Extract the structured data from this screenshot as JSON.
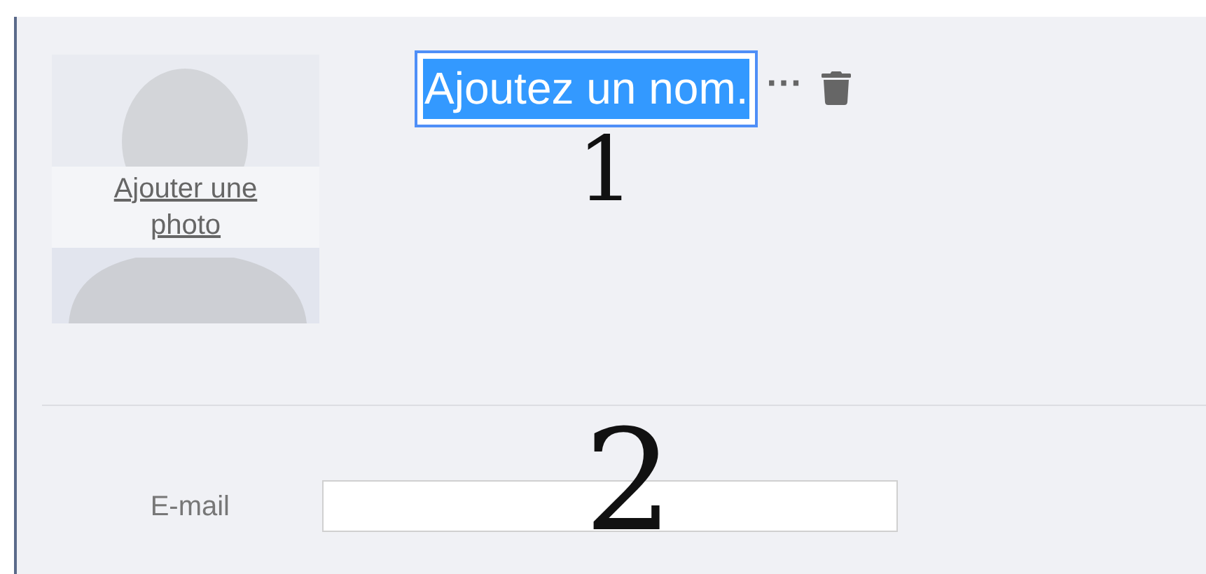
{
  "photo": {
    "link": "Ajouter une photo"
  },
  "name_field": {
    "value": "Ajoutez un nom.",
    "selected": true
  },
  "more_button": {
    "label": "···"
  },
  "fields": [
    {
      "label": "E-mail"
    }
  ],
  "annotations": [
    {
      "text": "1"
    },
    {
      "text": "2"
    }
  ]
}
